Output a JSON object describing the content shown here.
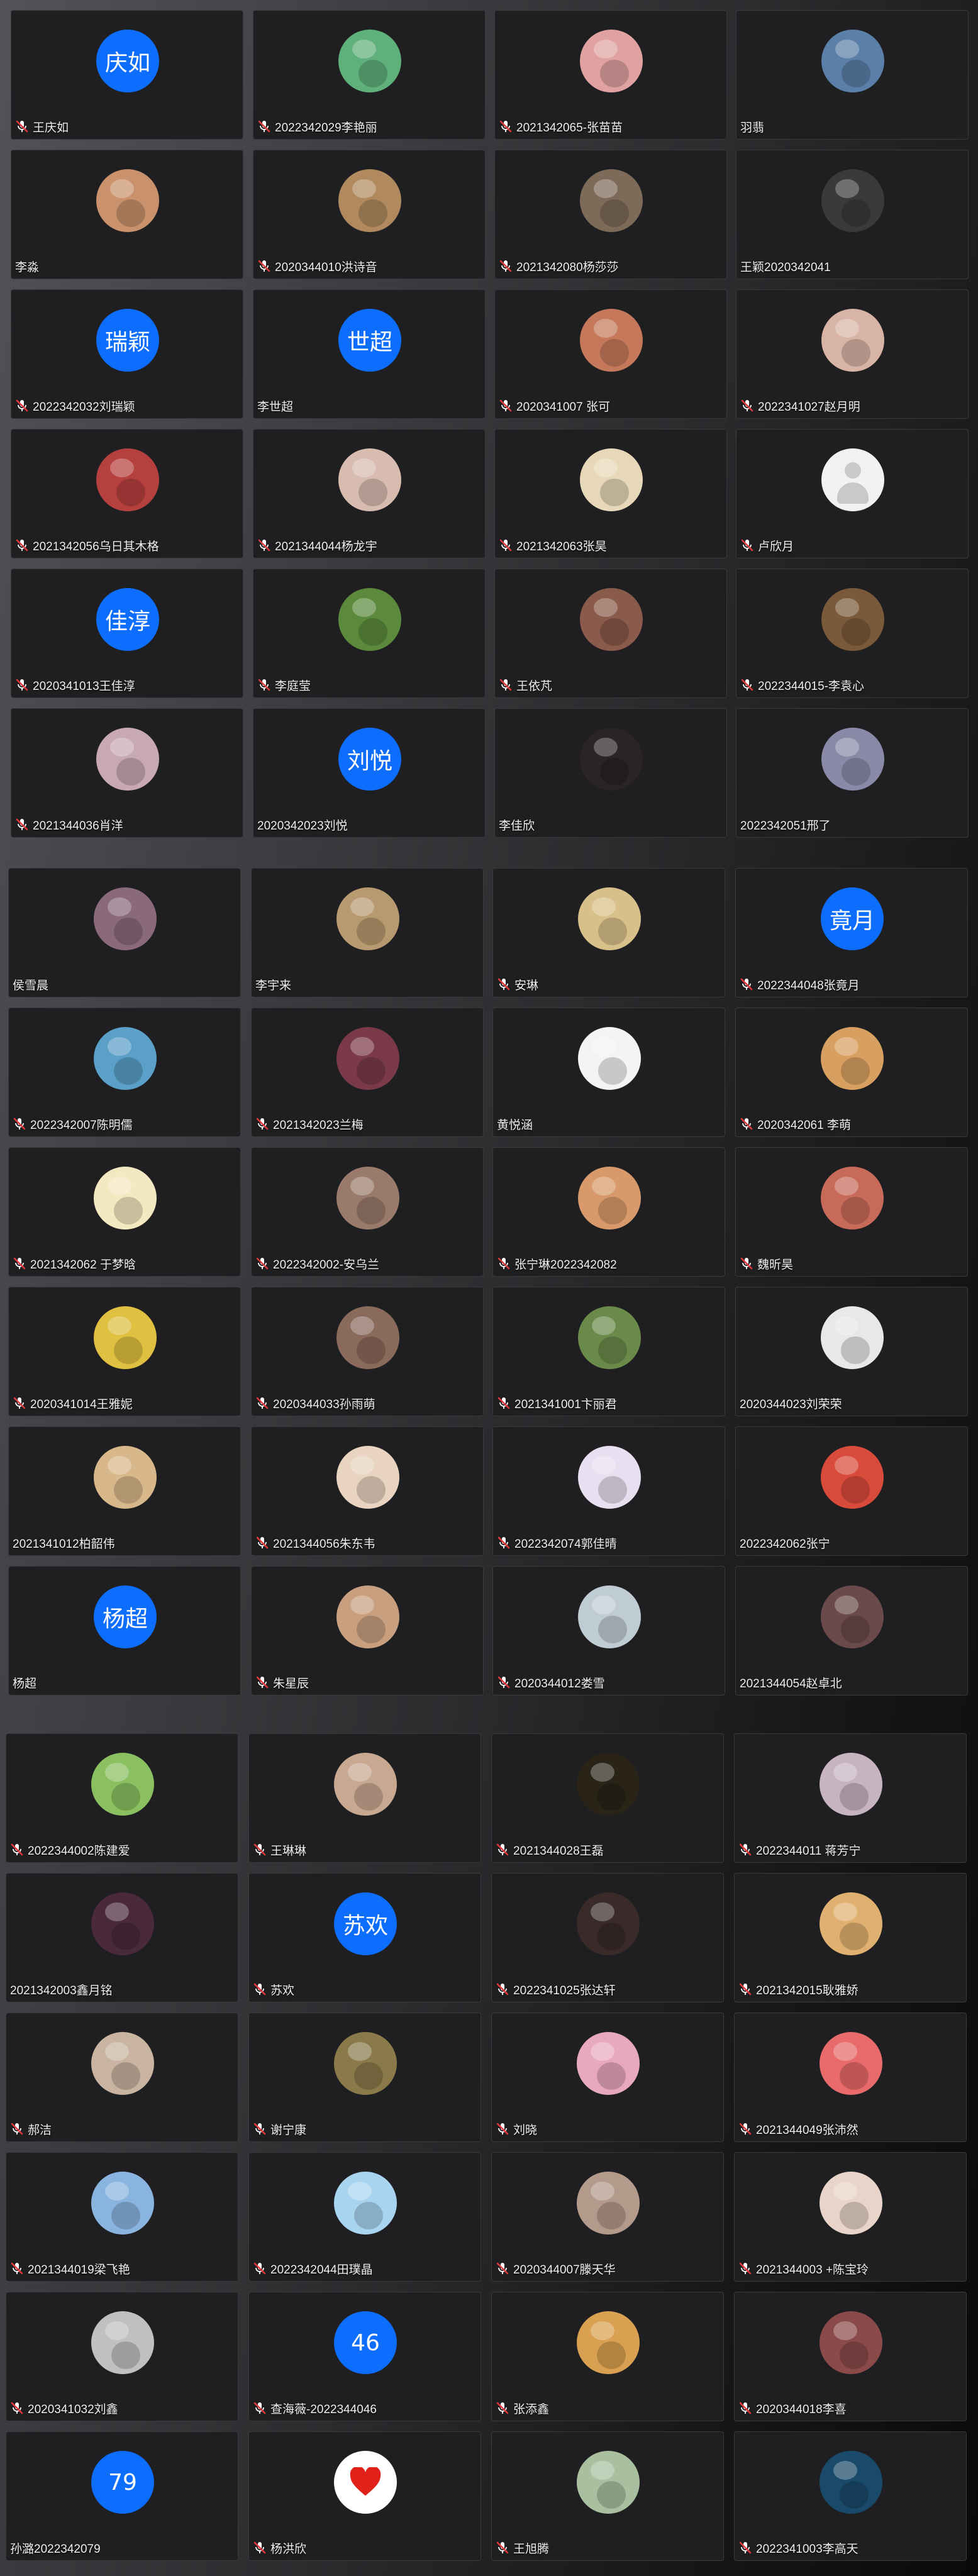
{
  "colors": {
    "tile_bg": "#1f1f22",
    "tile_border": "#3a3a3e",
    "text_avatar_blue": "#0d6efd",
    "name_text": "#f0f0f0",
    "mic_muted_red": "#e03a3a"
  },
  "sections": [
    {
      "rows": [
        [
          {
            "name": "王庆如",
            "avatar": {
              "kind": "text",
              "text": "庆如"
            },
            "mic": true
          },
          {
            "name": "2022342029李艳丽",
            "avatar": {
              "kind": "photo",
              "color": "#5fb07a"
            },
            "mic": true
          },
          {
            "name": "2021342065-张苗苗",
            "avatar": {
              "kind": "photo",
              "color": "#e0a2a0"
            },
            "mic": true
          },
          {
            "name": "羽翡",
            "avatar": {
              "kind": "photo",
              "color": "#5a7fa8"
            },
            "mic": false
          }
        ],
        [
          {
            "name": "李淼",
            "avatar": {
              "kind": "photo",
              "color": "#c9926c"
            },
            "mic": false
          },
          {
            "name": "2020344010洪诗音",
            "avatar": {
              "kind": "photo",
              "color": "#b08a5e"
            },
            "mic": true
          },
          {
            "name": "2021342080杨莎莎",
            "avatar": {
              "kind": "photo",
              "color": "#7d6a58"
            },
            "mic": true
          },
          {
            "name": "王颖2020342041",
            "avatar": {
              "kind": "photo",
              "color": "#3a3a3a"
            },
            "mic": false
          }
        ],
        [
          {
            "name": "2022342032刘瑞颖",
            "avatar": {
              "kind": "text",
              "text": "瑞颖"
            },
            "mic": true
          },
          {
            "name": "李世超",
            "avatar": {
              "kind": "text",
              "text": "世超"
            },
            "mic": false
          },
          {
            "name": "2020341007 张可",
            "avatar": {
              "kind": "photo",
              "color": "#c5795a"
            },
            "mic": true
          },
          {
            "name": "2022341027赵月明",
            "avatar": {
              "kind": "photo",
              "color": "#d8b4a6"
            },
            "mic": true
          }
        ],
        [
          {
            "name": "2021342056乌日其木格",
            "avatar": {
              "kind": "photo",
              "color": "#b6403e"
            },
            "mic": true
          },
          {
            "name": "2021344044杨龙宇",
            "avatar": {
              "kind": "photo",
              "color": "#d8bcb0"
            },
            "mic": true
          },
          {
            "name": "2021342063张昊",
            "avatar": {
              "kind": "photo",
              "color": "#e6d8b8"
            },
            "mic": true
          },
          {
            "name": "卢欣月",
            "avatar": {
              "kind": "default"
            },
            "mic": true
          }
        ],
        [
          {
            "name": "2020341013王佳淳",
            "avatar": {
              "kind": "text",
              "text": "佳淳"
            },
            "mic": true
          },
          {
            "name": "李庭莹",
            "avatar": {
              "kind": "photo",
              "color": "#5c8a3c"
            },
            "mic": true
          },
          {
            "name": "王依芃",
            "avatar": {
              "kind": "photo",
              "color": "#8a5a4a"
            },
            "mic": true
          },
          {
            "name": "2022344015-李袁心",
            "avatar": {
              "kind": "photo",
              "color": "#7a5a3a"
            },
            "mic": true
          }
        ],
        [
          {
            "name": "2021344036肖洋",
            "avatar": {
              "kind": "photo",
              "color": "#c8a8b4"
            },
            "mic": true
          },
          {
            "name": "2020342023刘悦",
            "avatar": {
              "kind": "text",
              "text": "刘悦"
            },
            "mic": false
          },
          {
            "name": "李佳欣",
            "avatar": {
              "kind": "photo",
              "color": "#2a2424"
            },
            "mic": false
          },
          {
            "name": "2022342051邢了",
            "avatar": {
              "kind": "photo",
              "color": "#8a8aa8"
            },
            "mic": false
          }
        ]
      ]
    },
    {
      "rows": [
        [
          {
            "name": "侯雪晨",
            "avatar": {
              "kind": "photo",
              "color": "#8a6a7a"
            },
            "mic": false
          },
          {
            "name": "李宇来",
            "avatar": {
              "kind": "photo",
              "color": "#b89a70"
            },
            "mic": false
          },
          {
            "name": "安琳",
            "avatar": {
              "kind": "photo",
              "color": "#d8c08a"
            },
            "mic": true
          },
          {
            "name": "2022344048张竟月",
            "avatar": {
              "kind": "text",
              "text": "竟月"
            },
            "mic": true
          }
        ],
        [
          {
            "name": "2022342007陈明儒",
            "avatar": {
              "kind": "photo",
              "color": "#5aa0c8"
            },
            "mic": true
          },
          {
            "name": "2021342023兰梅",
            "avatar": {
              "kind": "photo",
              "color": "#7a3a4a"
            },
            "mic": true
          },
          {
            "name": "黄悦涵",
            "avatar": {
              "kind": "photo",
              "color": "#f4f4f4"
            },
            "mic": false
          },
          {
            "name": "2020342061 李萌",
            "avatar": {
              "kind": "photo",
              "color": "#d8a060"
            },
            "mic": true
          }
        ],
        [
          {
            "name": "2021342062 于梦晗",
            "avatar": {
              "kind": "photo",
              "color": "#f4e8c0"
            },
            "mic": true
          },
          {
            "name": "2022342002-安乌兰",
            "avatar": {
              "kind": "photo",
              "color": "#9a7a6a"
            },
            "mic": true
          },
          {
            "name": "张宁琳2022342082",
            "avatar": {
              "kind": "photo",
              "color": "#d89a6a"
            },
            "mic": true
          },
          {
            "name": "魏昕昊",
            "avatar": {
              "kind": "photo",
              "color": "#c86a5a"
            },
            "mic": true
          }
        ],
        [
          {
            "name": "2020341014王雅妮",
            "avatar": {
              "kind": "photo",
              "color": "#e0c040"
            },
            "mic": true
          },
          {
            "name": "2020344033孙雨萌",
            "avatar": {
              "kind": "photo",
              "color": "#8a6a5a"
            },
            "mic": true
          },
          {
            "name": "2021341001卞丽君",
            "avatar": {
              "kind": "photo",
              "color": "#6a8a4a"
            },
            "mic": true
          },
          {
            "name": "2020344023刘荣荣",
            "avatar": {
              "kind": "photo",
              "color": "#e8e8e8"
            },
            "mic": false
          }
        ],
        [
          {
            "name": "2021341012柏韶伟",
            "avatar": {
              "kind": "photo",
              "color": "#d8b88a"
            },
            "mic": false
          },
          {
            "name": "2021344056朱东韦",
            "avatar": {
              "kind": "photo",
              "color": "#e8d4c0"
            },
            "mic": true
          },
          {
            "name": "2022342074郭佳晴",
            "avatar": {
              "kind": "photo",
              "color": "#e8e0f0"
            },
            "mic": true
          },
          {
            "name": "2022342062张宁",
            "avatar": {
              "kind": "photo",
              "color": "#d84a3a"
            },
            "mic": false
          }
        ],
        [
          {
            "name": "杨超",
            "avatar": {
              "kind": "text",
              "text": "杨超"
            },
            "mic": false
          },
          {
            "name": "朱星辰",
            "avatar": {
              "kind": "photo",
              "color": "#c8a080"
            },
            "mic": true
          },
          {
            "name": "2020344012娄雪",
            "avatar": {
              "kind": "photo",
              "color": "#c0ccd4"
            },
            "mic": true
          },
          {
            "name": "2021344054赵卓北",
            "avatar": {
              "kind": "photo",
              "color": "#6a4a4a"
            },
            "mic": false
          }
        ]
      ]
    },
    {
      "rows": [
        [
          {
            "name": "2022344002陈建爱",
            "avatar": {
              "kind": "photo",
              "color": "#8ac060"
            },
            "mic": true
          },
          {
            "name": "王琳琳",
            "avatar": {
              "kind": "photo",
              "color": "#c8a890"
            },
            "mic": true
          },
          {
            "name": "2021344028王磊",
            "avatar": {
              "kind": "photo",
              "color": "#2a2418"
            },
            "mic": true
          },
          {
            "name": "2022344011 蒋芳宁",
            "avatar": {
              "kind": "photo",
              "color": "#c8b4c0"
            },
            "mic": true
          }
        ],
        [
          {
            "name": "2021342003鑫月铭",
            "avatar": {
              "kind": "photo",
              "color": "#4a2a3a"
            },
            "mic": false
          },
          {
            "name": "苏欢",
            "avatar": {
              "kind": "text",
              "text": "苏欢"
            },
            "mic": true
          },
          {
            "name": "2022341025张达轩",
            "avatar": {
              "kind": "photo",
              "color": "#3a2a2a"
            },
            "mic": true
          },
          {
            "name": "2021342015耿雅娇",
            "avatar": {
              "kind": "photo",
              "color": "#e0b070"
            },
            "mic": true
          }
        ],
        [
          {
            "name": "郝洁",
            "avatar": {
              "kind": "photo",
              "color": "#c8b4a0"
            },
            "mic": true
          },
          {
            "name": "谢宁康",
            "avatar": {
              "kind": "photo",
              "color": "#8a7a4a"
            },
            "mic": true
          },
          {
            "name": "刘晓",
            "avatar": {
              "kind": "photo",
              "color": "#e8a8c0"
            },
            "mic": true
          },
          {
            "name": "2021344049张沛然",
            "avatar": {
              "kind": "photo",
              "color": "#e86a6a"
            },
            "mic": true
          }
        ],
        [
          {
            "name": "2021344019梁飞艳",
            "avatar": {
              "kind": "photo",
              "color": "#8ab4e0"
            },
            "mic": true
          },
          {
            "name": "2022342044田璞晶",
            "avatar": {
              "kind": "photo",
              "color": "#a8d4f0"
            },
            "mic": true
          },
          {
            "name": "2020344007滕天华",
            "avatar": {
              "kind": "photo",
              "color": "#b49a8a"
            },
            "mic": true
          },
          {
            "name": "2021344003 +陈宝玲",
            "avatar": {
              "kind": "photo",
              "color": "#e8d4c8"
            },
            "mic": true
          }
        ],
        [
          {
            "name": "2020341032刘鑫",
            "avatar": {
              "kind": "photo",
              "color": "#c0c0c0"
            },
            "mic": true
          },
          {
            "name": "查海薇-2022344046",
            "avatar": {
              "kind": "text",
              "text": "46"
            },
            "mic": true
          },
          {
            "name": "张添鑫",
            "avatar": {
              "kind": "photo",
              "color": "#d8a050"
            },
            "mic": true
          },
          {
            "name": "2020344018李喜",
            "avatar": {
              "kind": "photo",
              "color": "#8a4a4a"
            },
            "mic": true
          }
        ],
        [
          {
            "name": "孙潞2022342079",
            "avatar": {
              "kind": "text",
              "text": "79"
            },
            "mic": false
          },
          {
            "name": "杨洪欣",
            "avatar": {
              "kind": "heart"
            },
            "mic": true
          },
          {
            "name": "王旭腾",
            "avatar": {
              "kind": "photo",
              "color": "#a8c0a0"
            },
            "mic": true
          },
          {
            "name": "2022341003李高天",
            "avatar": {
              "kind": "photo",
              "color": "#1a4a6a"
            },
            "mic": true
          }
        ]
      ]
    }
  ]
}
